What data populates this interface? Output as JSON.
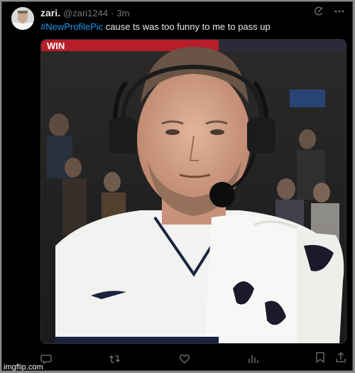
{
  "post": {
    "display_name": "zari.",
    "handle": "@zari1244",
    "separator": "·",
    "time": "3m",
    "hashtag": "#NewProfilePic",
    "text": " cause ts was too funny to me to pass up"
  },
  "media": {
    "banner_text": "WIN"
  },
  "icons": {
    "top": [
      "grok-icon",
      "more-icon"
    ],
    "actions": [
      "reply-icon",
      "repost-icon",
      "like-icon",
      "views-icon",
      "bookmark-icon",
      "share-icon"
    ]
  },
  "colors": {
    "background": "#000000",
    "accent": "#1d9bf0",
    "muted": "#71767b",
    "text": "#e7e9ea"
  },
  "watermark": "imgflip.com"
}
